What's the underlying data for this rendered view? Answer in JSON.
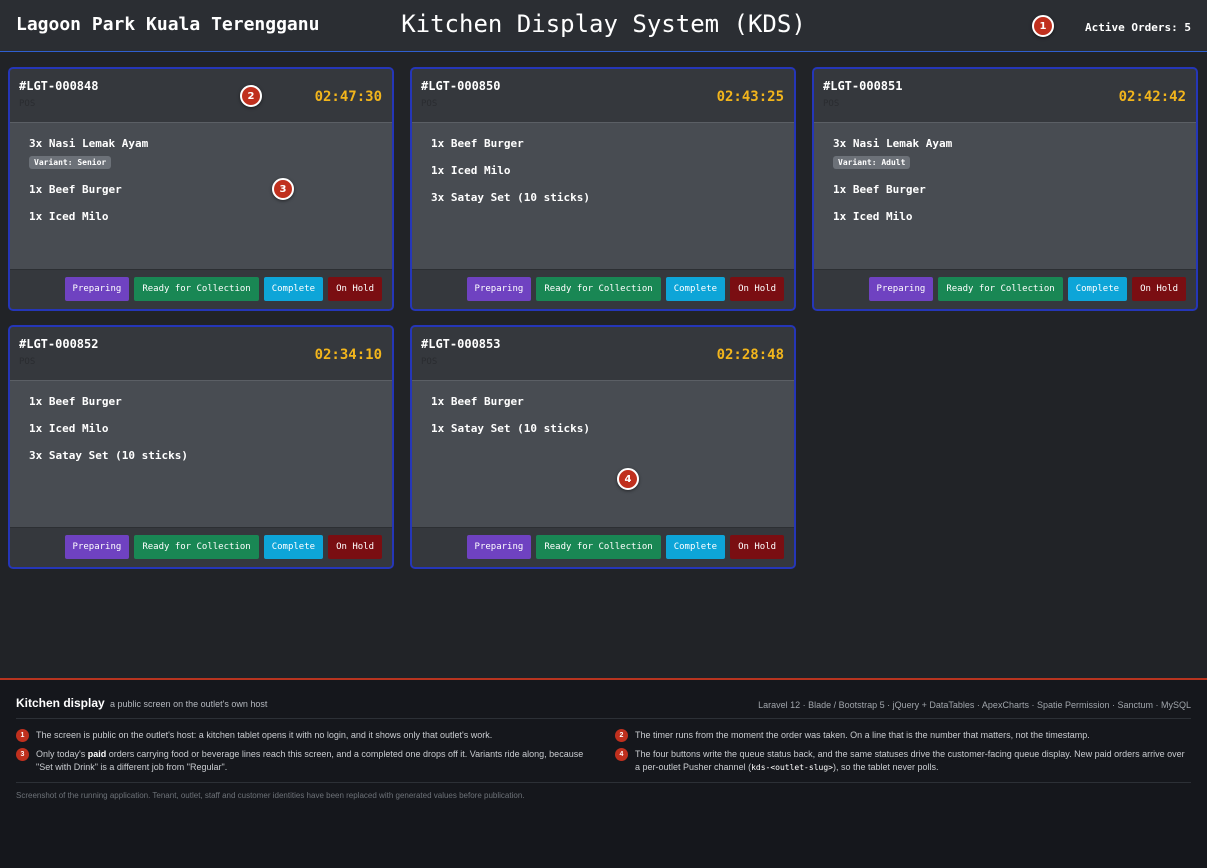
{
  "header": {
    "outlet_name": "Lagoon Park Kuala Terengganu",
    "title": "Kitchen Display System (KDS)",
    "active_orders_label": "Active Orders: 5"
  },
  "buttons": {
    "preparing": "Preparing",
    "ready": "Ready for Collection",
    "complete": "Complete",
    "hold": "On Hold"
  },
  "orders": [
    {
      "number": "#LGT-000848",
      "source": "POS",
      "timer": "02:47:30",
      "items": [
        {
          "name": "3x Nasi Lemak Ayam",
          "variant": "Variant: Senior"
        },
        {
          "name": "1x Beef Burger"
        },
        {
          "name": "1x Iced Milo"
        }
      ]
    },
    {
      "number": "#LGT-000850",
      "source": "POS",
      "timer": "02:43:25",
      "items": [
        {
          "name": "1x Beef Burger"
        },
        {
          "name": "1x Iced Milo"
        },
        {
          "name": "3x Satay Set (10 sticks)"
        }
      ]
    },
    {
      "number": "#LGT-000851",
      "source": "POS",
      "timer": "02:42:42",
      "items": [
        {
          "name": "3x Nasi Lemak Ayam",
          "variant": "Variant: Adult"
        },
        {
          "name": "1x Beef Burger"
        },
        {
          "name": "1x Iced Milo"
        }
      ]
    },
    {
      "number": "#LGT-000852",
      "source": "POS",
      "timer": "02:34:10",
      "items": [
        {
          "name": "1x Beef Burger"
        },
        {
          "name": "1x Iced Milo"
        },
        {
          "name": "3x Satay Set (10 sticks)"
        }
      ]
    },
    {
      "number": "#LGT-000853",
      "source": "POS",
      "timer": "02:28:48",
      "items": [
        {
          "name": "1x Beef Burger"
        },
        {
          "name": "1x Satay Set (10 sticks)"
        }
      ]
    }
  ],
  "markers": [
    "1",
    "2",
    "3",
    "4"
  ],
  "footer": {
    "title": "Kitchen display",
    "subtitle": "a public screen on the outlet's own host",
    "tech_stack": "Laravel 12 · Blade / Bootstrap 5 · jQuery + DataTables · ApexCharts · Spatie Permission · Sanctum · MySQL",
    "notes": {
      "n1": "The screen is public on the outlet's host: a kitchen tablet opens it with no login, and it shows only that outlet's work.",
      "n2": "The timer runs from the moment the order was taken. On a line that is the number that matters, not the timestamp.",
      "n3_pre": "Only today's ",
      "n3_bold": "paid",
      "n3_post": " orders carrying food or beverage lines reach this screen, and a completed one drops off it. Variants ride along, because \"Set with Drink\" is a different job from \"Regular\".",
      "n4_pre": "The four buttons write the queue status back, and the same statuses drive the customer-facing queue display. New paid orders arrive over a per-outlet Pusher channel (",
      "n4_code": "kds-<outlet-slug>",
      "n4_post": "), so the tablet never polls."
    },
    "disclaimer": "Screenshot of the running application. Tenant, outlet, staff and customer identities have been replaced with generated values before publication."
  },
  "colors": {
    "accent_border": "#2536b8",
    "timer": "#f2b51c",
    "preparing": "#6f42c1",
    "ready": "#198754",
    "complete": "#0da5d8",
    "hold": "#7a0e12",
    "marker": "#c0301e"
  }
}
